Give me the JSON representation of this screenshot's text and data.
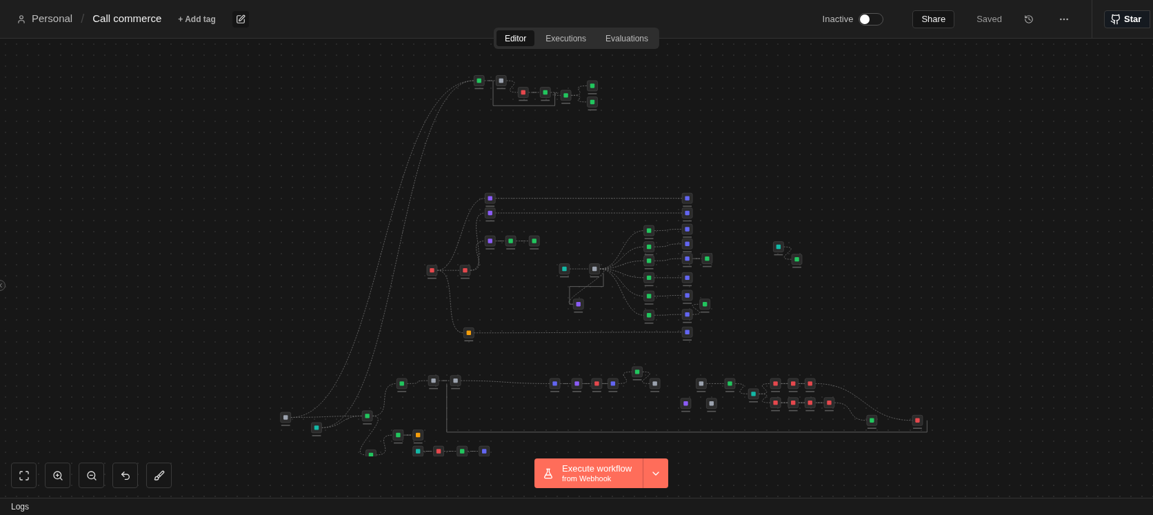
{
  "header": {
    "breadcrumb": "Personal",
    "separator": "/",
    "title": "Call commerce",
    "add_tag": "+ Add tag",
    "active_toggle": {
      "label": "Inactive",
      "on": false
    },
    "share": "Share",
    "saved": "Saved",
    "star": "Star"
  },
  "tabs": [
    {
      "label": "Editor",
      "selected": true
    },
    {
      "label": "Executions",
      "selected": false
    },
    {
      "label": "Evaluations",
      "selected": false
    }
  ],
  "execute": {
    "label": "Execute workflow",
    "sub": "from Webhook"
  },
  "logs": "Logs"
}
